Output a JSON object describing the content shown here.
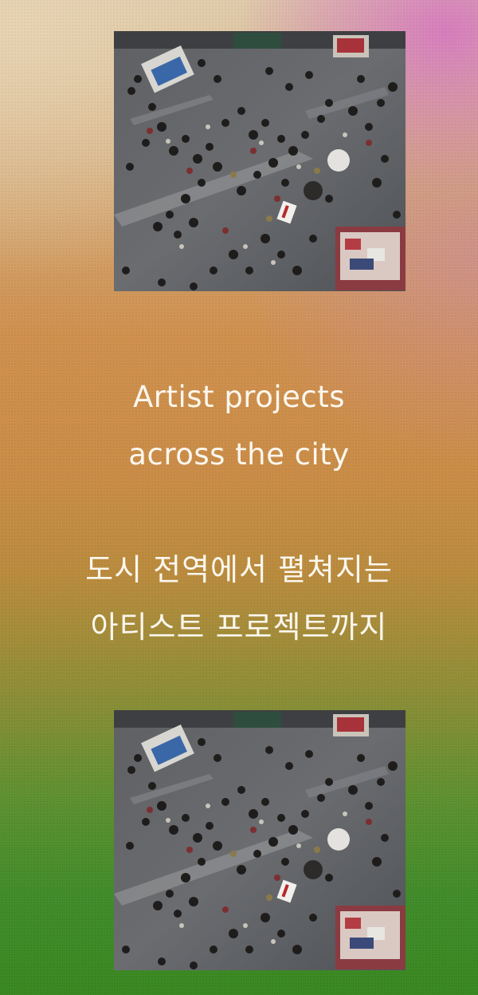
{
  "hero": {
    "title_en_line1": "Artist projects",
    "title_en_line2": "across the city",
    "title_ko_line1": "도시 전역에서 펼쳐지는",
    "title_ko_line2": "아티스트 프로젝트까지"
  },
  "images": {
    "top": {
      "subject": "aerial-crowd-street-photo"
    },
    "bottom": {
      "subject": "aerial-crowd-street-photo"
    }
  },
  "colors": {
    "text": "#fbf7ef",
    "gradient_top": "#dcc7a7",
    "gradient_mid": "#cf8f4c",
    "gradient_bottom": "#37861f",
    "accent_pink": "#d678be"
  }
}
